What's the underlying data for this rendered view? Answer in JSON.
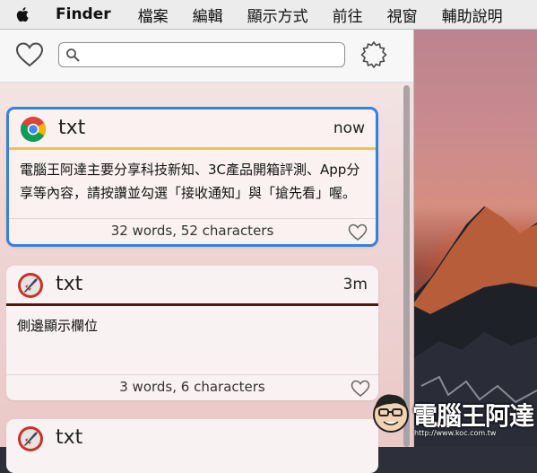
{
  "menubar": {
    "apple_icon": "apple-icon",
    "app_name": "Finder",
    "items": [
      "檔案",
      "編輯",
      "顯示方式",
      "前往",
      "視窗",
      "輔助說明"
    ]
  },
  "toolbar": {
    "heart_icon": "heart-icon",
    "search_icon": "search-icon",
    "search_value": "",
    "search_placeholder": "",
    "settings_icon": "gear-icon"
  },
  "colors": {
    "selection": "#3a7fd9",
    "card1_rule": "#f1c04a",
    "card2_rule": "#4a1a14"
  },
  "cards": [
    {
      "app_icon": "chrome-icon",
      "title": "txt",
      "time": "now",
      "body": "電腦王阿達主要分享科技新知、3C產品開箱評測、App分享等內容，請按讚並勾選「接收通知」與「搶先看」喔。",
      "stats": "32 words, 52 characters",
      "selected": true
    },
    {
      "app_icon": "rocket-icon",
      "title": "txt",
      "time": "3m",
      "body": "側邊顯示欄位",
      "stats": "3 words, 6 characters",
      "selected": false
    },
    {
      "app_icon": "rocket-icon",
      "title": "txt",
      "time": "",
      "body": "",
      "stats": "",
      "selected": false
    }
  ],
  "watermark": {
    "text": "電腦王阿達",
    "url": "http://www.koc.com.tw"
  }
}
